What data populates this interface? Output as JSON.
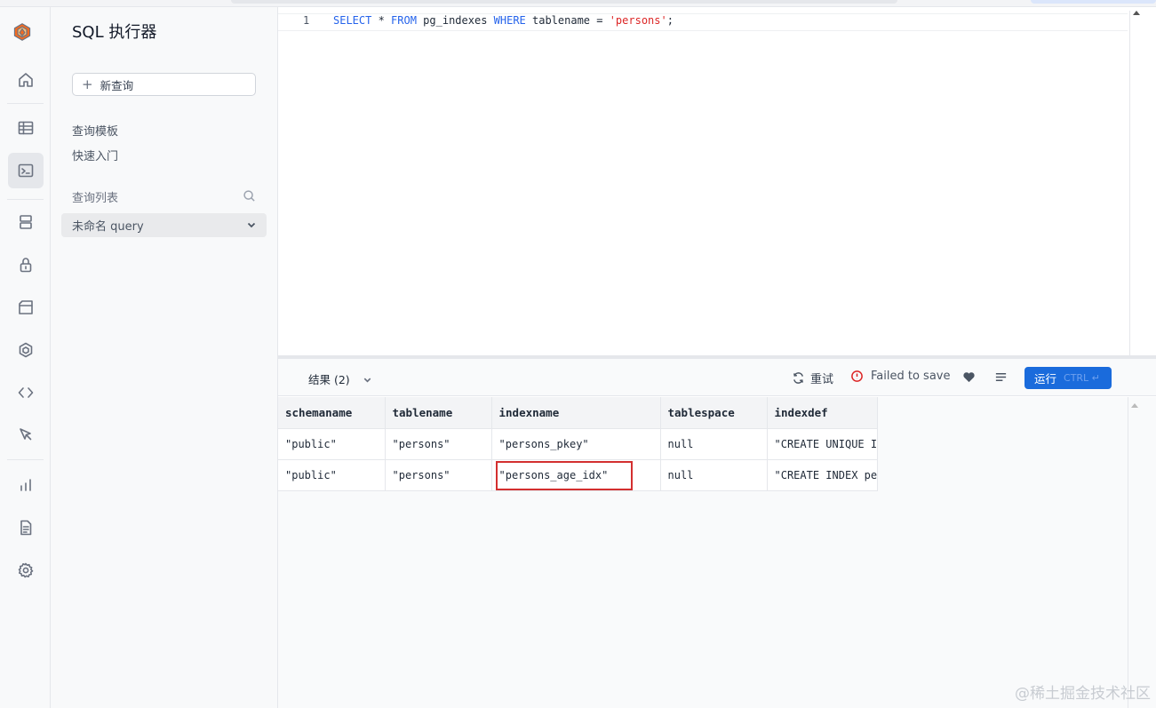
{
  "sidebar": {
    "title": "SQL 执行器",
    "new_query": "新查询",
    "links": [
      "查询模板",
      "快速入门"
    ],
    "list_header": "查询列表",
    "query_item": "未命名 query"
  },
  "editor": {
    "line_number": "1",
    "code": {
      "kw1": "SELECT",
      "t1": " * ",
      "kw2": "FROM",
      "t2": " pg_indexes ",
      "kw3": "WHERE",
      "t3": " tablename = ",
      "str": "'persons'",
      "t4": ";"
    }
  },
  "toolbar": {
    "results_label": "结果 (2)",
    "retry_label": "重试",
    "save_status": "Failed to save",
    "run_label": "运行",
    "run_shortcut": "CTRL ↵"
  },
  "results": {
    "columns": [
      "schemaname",
      "tablename",
      "indexname",
      "tablespace",
      "indexdef"
    ],
    "rows": [
      [
        "\"public\"",
        "\"persons\"",
        "\"persons_pkey\"",
        "null",
        "\"CREATE UNIQUE I"
      ],
      [
        "\"public\"",
        "\"persons\"",
        "\"persons_age_idx\"",
        "null",
        "\"CREATE INDEX pe"
      ]
    ]
  },
  "watermark": "@稀土掘金技术社区",
  "colors": {
    "accent": "#1a6bdc",
    "highlight_box": "#d32f2f",
    "error": "#dc2626"
  }
}
